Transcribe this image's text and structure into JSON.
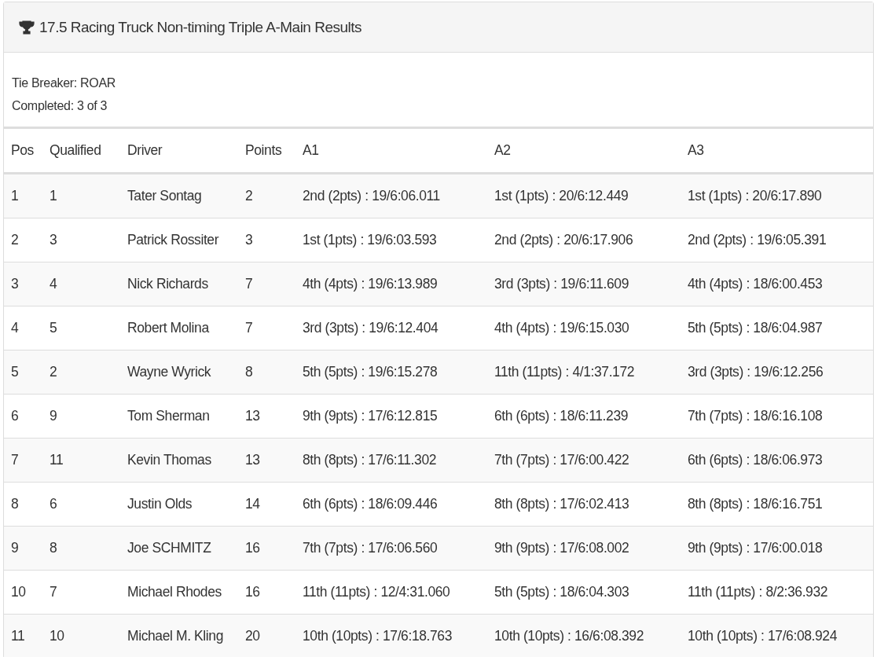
{
  "panel": {
    "title": "17.5 Racing Truck Non-timing Triple A-Main Results"
  },
  "info": [
    "Tie Breaker: ROAR",
    "Completed: 3 of 3"
  ],
  "table": {
    "columns": [
      "Pos",
      "Qualified",
      "Driver",
      "Points",
      "A1",
      "A2",
      "A3"
    ],
    "rows": [
      [
        "1",
        "1",
        "Tater Sontag",
        "2",
        "2nd (2pts) : 19/6:06.011",
        "1st (1pts) : 20/6:12.449",
        "1st (1pts) : 20/6:17.890"
      ],
      [
        "2",
        "3",
        "Patrick Rossiter",
        "3",
        "1st (1pts) : 19/6:03.593",
        "2nd (2pts) : 20/6:17.906",
        "2nd (2pts) : 19/6:05.391"
      ],
      [
        "3",
        "4",
        "Nick Richards",
        "7",
        "4th (4pts) : 19/6:13.989",
        "3rd (3pts) : 19/6:11.609",
        "4th (4pts) : 18/6:00.453"
      ],
      [
        "4",
        "5",
        "Robert Molina",
        "7",
        "3rd (3pts) : 19/6:12.404",
        "4th (4pts) : 19/6:15.030",
        "5th (5pts) : 18/6:04.987"
      ],
      [
        "5",
        "2",
        "Wayne Wyrick",
        "8",
        "5th (5pts) : 19/6:15.278",
        "11th (11pts) : 4/1:37.172",
        "3rd (3pts) : 19/6:12.256"
      ],
      [
        "6",
        "9",
        "Tom Sherman",
        "13",
        "9th (9pts) : 17/6:12.815",
        "6th (6pts) : 18/6:11.239",
        "7th (7pts) : 18/6:16.108"
      ],
      [
        "7",
        "11",
        "Kevin Thomas",
        "13",
        "8th (8pts) : 17/6:11.302",
        "7th (7pts) : 17/6:00.422",
        "6th (6pts) : 18/6:06.973"
      ],
      [
        "8",
        "6",
        "Justin Olds",
        "14",
        "6th (6pts) : 18/6:09.446",
        "8th (8pts) : 17/6:02.413",
        "8th (8pts) : 18/6:16.751"
      ],
      [
        "9",
        "8",
        "Joe SCHMITZ",
        "16",
        "7th (7pts) : 17/6:06.560",
        "9th (9pts) : 17/6:08.002",
        "9th (9pts) : 17/6:00.018"
      ],
      [
        "10",
        "7",
        "Michael Rhodes",
        "16",
        "11th (11pts) : 12/4:31.060",
        "5th (5pts) : 18/6:04.303",
        "11th (11pts) : 8/2:36.932"
      ],
      [
        "11",
        "10",
        "Michael M. Kling",
        "20",
        "10th (10pts) : 17/6:18.763",
        "10th (10pts) : 16/6:08.392",
        "10th (10pts) : 17/6:08.924"
      ]
    ]
  }
}
